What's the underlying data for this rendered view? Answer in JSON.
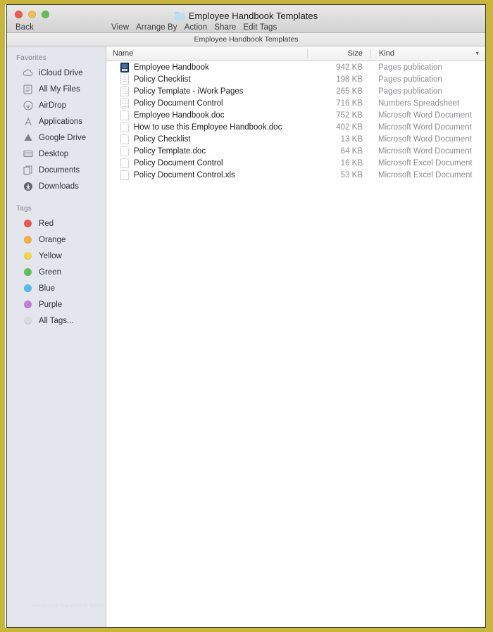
{
  "window": {
    "title": "Employee Handbook Templates",
    "folder_icon": "folder-icon",
    "back_label": "Back",
    "traffic_lights": [
      "close",
      "minimize",
      "zoom"
    ],
    "path_bar": "Employee Handbook Templates"
  },
  "toolbar": {
    "items": [
      {
        "label": "View"
      },
      {
        "label": "Arrange By"
      },
      {
        "label": "Action"
      },
      {
        "label": "Share"
      },
      {
        "label": "Edit Tags"
      }
    ]
  },
  "sidebar": {
    "favorites_header": "Favorites",
    "favorites": [
      {
        "label": "iCloud Drive",
        "icon": "icloud-drive-icon"
      },
      {
        "label": "All My Files",
        "icon": "all-my-files-icon"
      },
      {
        "label": "AirDrop",
        "icon": "airdrop-icon"
      },
      {
        "label": "Applications",
        "icon": "applications-icon"
      },
      {
        "label": "Google Drive",
        "icon": "google-drive-icon"
      },
      {
        "label": "Desktop",
        "icon": "desktop-icon"
      },
      {
        "label": "Documents",
        "icon": "documents-icon"
      },
      {
        "label": "Downloads",
        "icon": "downloads-icon"
      }
    ],
    "tags_header": "Tags",
    "tags": [
      {
        "label": "Red",
        "color": "#f0564d"
      },
      {
        "label": "Orange",
        "color": "#f7ae3f"
      },
      {
        "label": "Yellow",
        "color": "#f5d34b"
      },
      {
        "label": "Green",
        "color": "#5fc357"
      },
      {
        "label": "Blue",
        "color": "#54bdee"
      },
      {
        "label": "Purple",
        "color": "#c77ae0"
      },
      {
        "label": "All Tags...",
        "color": "#d8dade"
      }
    ]
  },
  "columns": {
    "name": "Name",
    "size": "Size",
    "kind": "Kind",
    "sort_icon": "chevron-down-icon"
  },
  "files": [
    {
      "name": "Employee Handbook",
      "size": "942 KB",
      "kind": "Pages publication",
      "icon": "pages-thumbnail-icon"
    },
    {
      "name": "Policy Checklist",
      "size": "198 KB",
      "kind": "Pages publication",
      "icon": "checklist-document-icon"
    },
    {
      "name": "Policy Template - iWork Pages",
      "size": "265 KB",
      "kind": "Pages publication",
      "icon": "checklist-document-icon"
    },
    {
      "name": "Policy Document Control",
      "size": "716 KB",
      "kind": "Numbers Spreadsheet",
      "icon": "spreadsheet-document-icon"
    },
    {
      "name": "Employee Handbook.doc",
      "size": "752 KB",
      "kind": "Microsoft Word Document",
      "icon": "generic-document-icon"
    },
    {
      "name": "How to use this Employee Handbook.doc",
      "size": "402 KB",
      "kind": "Microsoft Word Document",
      "icon": "generic-document-icon"
    },
    {
      "name": "Policy Checklist",
      "size": "13 KB",
      "kind": "Microsoft Word Document",
      "icon": "generic-document-icon"
    },
    {
      "name": "Policy Template.doc",
      "size": "64 KB",
      "kind": "Microsoft Word Document",
      "icon": "generic-document-icon"
    },
    {
      "name": "Policy Document Control",
      "size": "16 KB",
      "kind": "Microsoft Excel Document",
      "icon": "generic-document-icon"
    },
    {
      "name": "Policy Document Control.xls",
      "size": "53 KB",
      "kind": "Microsoft Excel Document",
      "icon": "generic-document-icon"
    }
  ],
  "watermark": {
    "text": "employee handbook templates"
  },
  "colors": {
    "frame": "#c8b63a",
    "sidebar_bg": "#e3e7ed",
    "titlebar_bg": "#dcdcdc",
    "secondary_text": "#8b8b90"
  }
}
